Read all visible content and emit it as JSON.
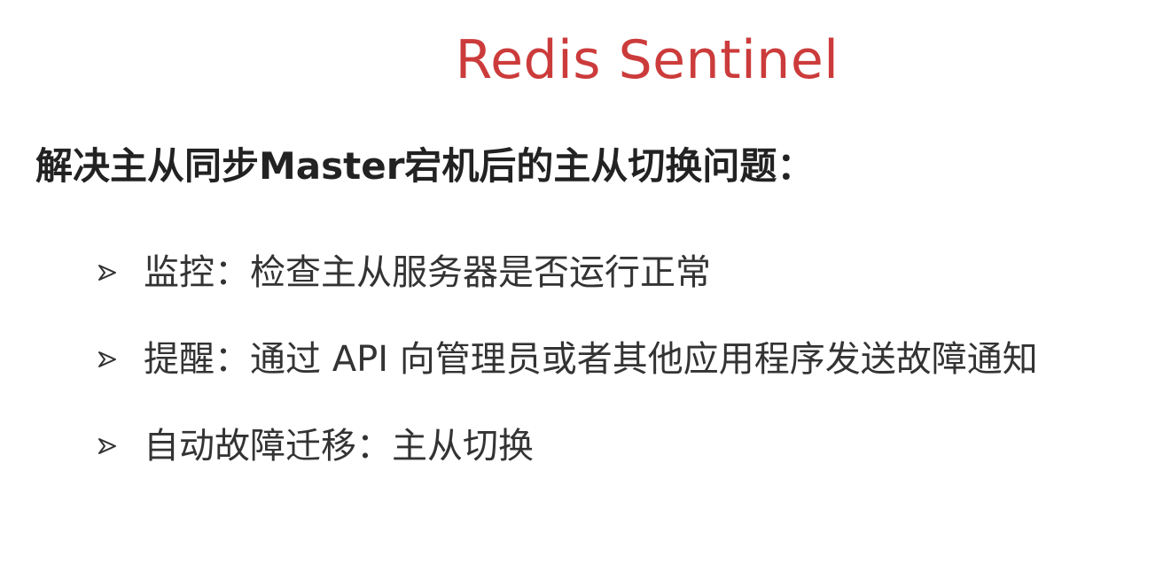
{
  "slide": {
    "title": "Redis Sentinel",
    "title_color": "#cc3b3b",
    "headline": "解决主从同步Master宕机后的主从切换问题：",
    "bullets": [
      {
        "icon": "arrow-bullet-icon",
        "text": "监控：检查主从服务器是否运行正常"
      },
      {
        "icon": "arrow-bullet-icon",
        "text": "提醒：通过 API 向管理员或者其他应用程序发送故障通知"
      },
      {
        "icon": "arrow-bullet-icon",
        "text": "自动故障迁移：主从切换"
      }
    ]
  }
}
